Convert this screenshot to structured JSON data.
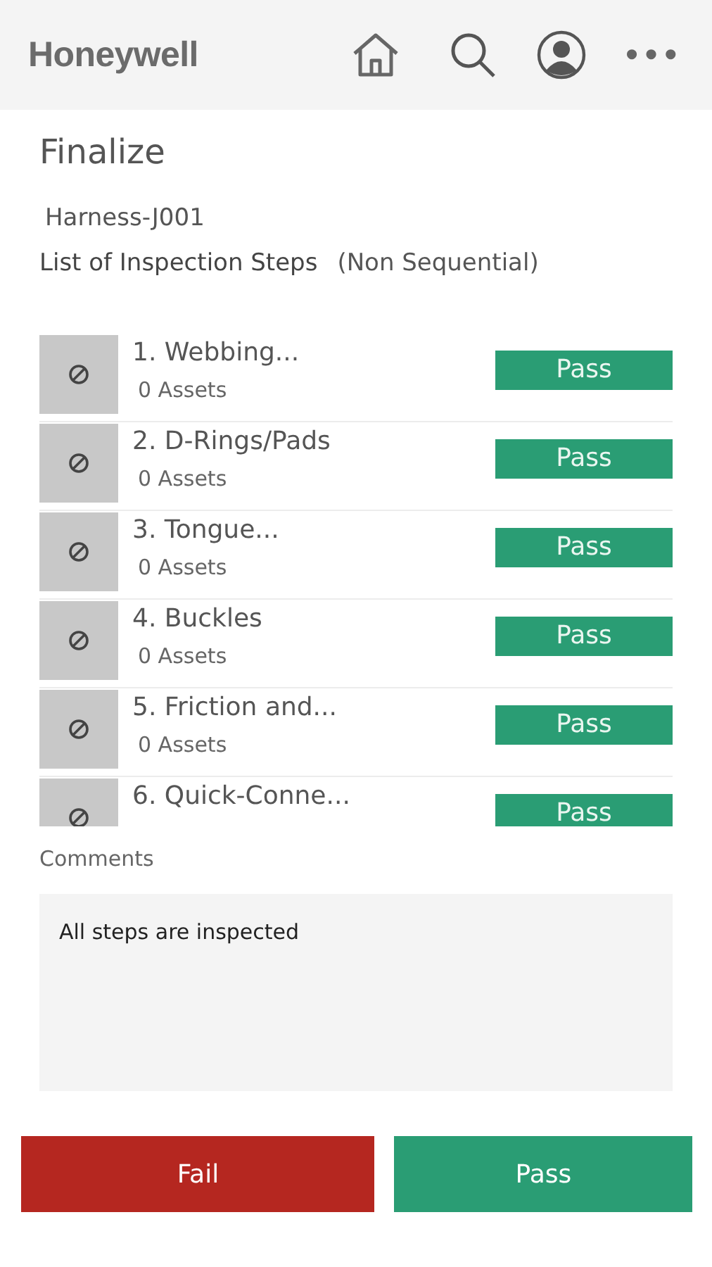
{
  "header": {
    "logo": "Honeywell",
    "more": "•••"
  },
  "page_title": "Finalize",
  "asset_name": "Harness-J001",
  "list_heading": {
    "label": "List of Inspection Steps",
    "note": "(Non Sequential)"
  },
  "steps": [
    {
      "title": "1. Webbing...",
      "assets": "0 Assets",
      "result": "Pass"
    },
    {
      "title": "2. D-Rings/Pads",
      "assets": "0 Assets",
      "result": "Pass"
    },
    {
      "title": "3. Tongue...",
      "assets": "0 Assets",
      "result": "Pass"
    },
    {
      "title": "4. Buckles",
      "assets": "0 Assets",
      "result": "Pass"
    },
    {
      "title": "5. Friction and...",
      "assets": "0 Assets",
      "result": "Pass"
    },
    {
      "title": "6. Quick-Conne...",
      "result": "Pass"
    }
  ],
  "comments": {
    "label": "Comments",
    "value": "All steps are inspected"
  },
  "actions": [
    {
      "label": "Fail",
      "kind": "fail"
    },
    {
      "label": "Pass",
      "kind": "pass"
    }
  ]
}
